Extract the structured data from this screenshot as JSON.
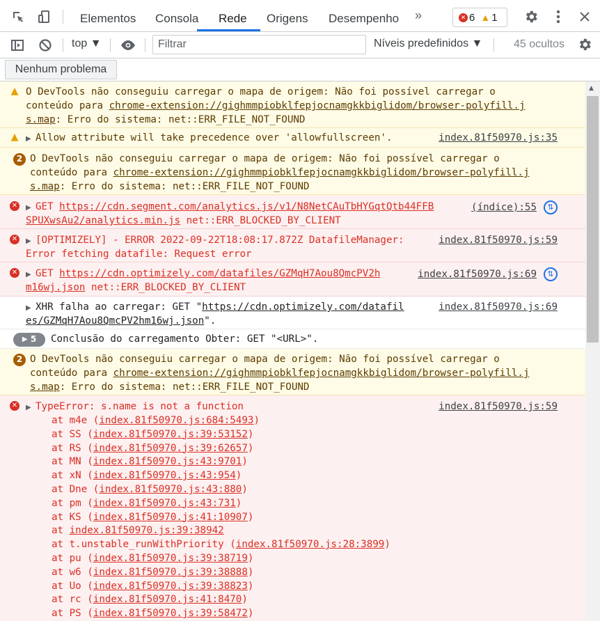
{
  "tabs": [
    "Elementos",
    "Consola",
    "Rede",
    "Origens",
    "Desempenho"
  ],
  "active_tab": "Rede",
  "more_tabs": "»",
  "badges": {
    "errors": "6",
    "warnings": "1"
  },
  "toolbar": {
    "context": "top ▼",
    "filter_placeholder": "Filtrar",
    "levels": "Níveis predefinidos ▼",
    "hidden": "45 ocultos"
  },
  "issues_button": "Nenhum problema",
  "messages": {
    "m1": {
      "l1": "O DevTools não conseguiu carregar o mapa de origem: Não foi possível carregar o",
      "l2a": "conteúdo para ",
      "l2link": "chrome-extension://gighmmpiobklfepjocnamgkkbiglidom/browser-polyfill.j",
      "l3link": "s.map",
      "l3b": ": Erro do sistema: net::ERR_FILE_NOT_FOUND"
    },
    "m2": {
      "text": "Allow attribute will take precedence over 'allowfullscreen'.",
      "src": "index.81f50970.js:35"
    },
    "m3": {
      "count": "2",
      "l1": "O DevTools não conseguiu carregar o mapa de origem: Não foi possível carregar o",
      "l2a": "conteúdo para ",
      "l2link": "chrome-extension://gighmmpiobklfepjocnamgkkbiglidom/browser-polyfill.j",
      "l3link": "s.map",
      "l3b": ": Erro do sistema: net::ERR_FILE_NOT_FOUND"
    },
    "m4": {
      "method": "GET ",
      "link1": "https://cdn.segment.com/analytics.js/v1/N8NetCAuTbHYGqtQtb44FFB",
      "link2": "SPUXwsAu2/analytics.min.js",
      "tail": " net::ERR_BLOCKED_BY_CLIENT",
      "src": "(índice):55"
    },
    "m5": {
      "l1": "[OPTIMIZELY] - ERROR 2022-09-22T18:08:17.872Z DatafileManager:",
      "l2": "Error fetching datafile: Request error",
      "src": "index.81f50970.js:59"
    },
    "m6": {
      "method": "GET ",
      "link1": "https://cdn.optimizely.com/datafiles/GZMqH7Aou8QmcPV2h",
      "link2": "m16wj.json",
      "tail": " net::ERR_BLOCKED_BY_CLIENT",
      "src": "index.81f50970.js:69"
    },
    "m7": {
      "l1a": "XHR falha ao carregar: GET \"",
      "l1link": "https://cdn.optimizely.com/datafil",
      "l2link": "es/GZMqH7Aou8QmcPV2hm16wj.json",
      "l2b": "\".",
      "src": "index.81f50970.js:69"
    },
    "m8": {
      "count": "5",
      "text": "Conclusão do carregamento Obter: GET \"<URL>\"."
    },
    "m9": {
      "count": "2",
      "l1": "O DevTools não conseguiu carregar o mapa de origem: Não foi possível carregar o",
      "l2a": "conteúdo para ",
      "l2link": "chrome-extension://gighmmpiobklfepjocnamgkkbiglidom/browser-polyfill.j",
      "l3link": "s.map",
      "l3b": ": Erro do sistema: net::ERR_FILE_NOT_FOUND"
    },
    "m10": {
      "head": "TypeError: s.name is not a function",
      "src": "index.81f50970.js:59",
      "stack": [
        {
          "fn": "m4e ",
          "loc": "index.81f50970.js:684:5493",
          "paren": true
        },
        {
          "fn": "SS ",
          "loc": "index.81f50970.js:39:53152",
          "paren": true
        },
        {
          "fn": "RS ",
          "loc": "index.81f50970.js:39:62657",
          "paren": true
        },
        {
          "fn": "MN ",
          "loc": "index.81f50970.js:43:9701",
          "paren": true
        },
        {
          "fn": "xN ",
          "loc": "index.81f50970.js:43:954",
          "paren": true
        },
        {
          "fn": "Dne ",
          "loc": "index.81f50970.js:43:880",
          "paren": true
        },
        {
          "fn": "pm ",
          "loc": "index.81f50970.js:43:731",
          "paren": true
        },
        {
          "fn": "KS ",
          "loc": "index.81f50970.js:41:10907",
          "paren": true
        },
        {
          "fn": "",
          "loc": "index.81f50970.js:39:38942",
          "paren": false
        },
        {
          "fn": "t.unstable_runWithPriority ",
          "loc": "index.81f50970.js:28:3899",
          "paren": true
        },
        {
          "fn": "pu ",
          "loc": "index.81f50970.js:39:38719",
          "paren": true
        },
        {
          "fn": "w6 ",
          "loc": "index.81f50970.js:39:38888",
          "paren": true
        },
        {
          "fn": "Uo ",
          "loc": "index.81f50970.js:39:38823",
          "paren": true
        },
        {
          "fn": "rc ",
          "loc": "index.81f50970.js:41:8470",
          "paren": true
        },
        {
          "fn": "PS ",
          "loc": "index.81f50970.js:39:58472",
          "paren": true
        }
      ]
    }
  }
}
